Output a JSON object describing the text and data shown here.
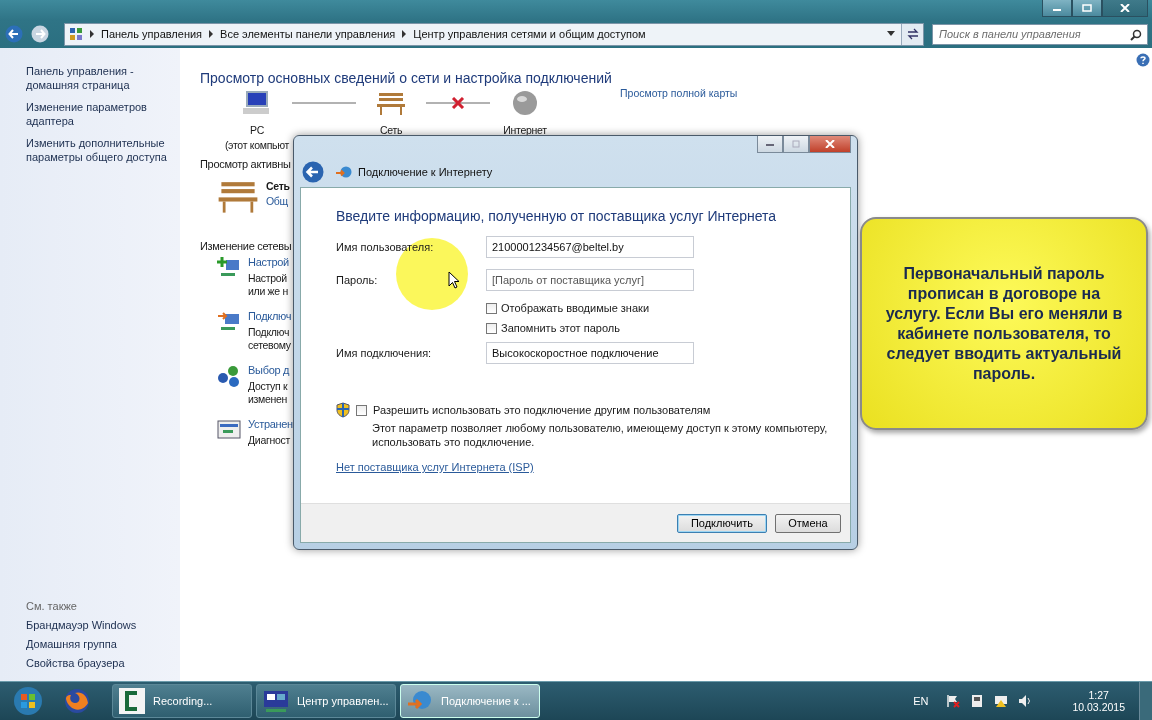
{
  "address_bar": {
    "breadcrumbs": [
      "Панель управления",
      "Все элементы панели управления",
      "Центр управления сетями и общим доступом"
    ],
    "search": {
      "placeholder": "Поиск в панели управления"
    }
  },
  "sidebar": {
    "links": [
      "Панель управления - домашняя страница",
      "Изменение параметров адаптера",
      "Изменить дополнительные параметры общего доступа"
    ],
    "see_also_heading": "См. также",
    "see_also": [
      "Брандмауэр Windows",
      "Домашняя группа",
      "Свойства браузера"
    ]
  },
  "main": {
    "heading": "Просмотр основных сведений о сети и настройка подключений",
    "map": {
      "nodes": [
        {
          "kind": "computer",
          "label": "PC",
          "sublabel": "(этот компьют"
        },
        {
          "kind": "network",
          "label": "Сеть"
        },
        {
          "kind": "internet",
          "label": "Интернет"
        }
      ],
      "connections": [
        {
          "broken": false
        },
        {
          "broken": true
        }
      ],
      "link": "Просмотр полной карты"
    },
    "active_heading": "Просмотр активны",
    "network": {
      "name": "Сеть",
      "type": "Общ"
    },
    "change_heading": "Изменение сетевы",
    "tasks": [
      {
        "kind": "setup",
        "title": "Настрой",
        "lines": [
          "Настрой",
          "или же н"
        ]
      },
      {
        "kind": "connect",
        "title": "Подключ",
        "lines": [
          "Подключ",
          "сетевому"
        ]
      },
      {
        "kind": "homegroup",
        "title": "Выбор д",
        "lines": [
          "Доступ к",
          "изменен"
        ]
      },
      {
        "kind": "troubleshoot",
        "title": "Устранен",
        "lines": [
          "Диагност"
        ]
      }
    ]
  },
  "dialog": {
    "title": "Подключение к Интернету",
    "heading": "Введите информацию, полученную от поставщика услуг Интернета",
    "fields": [
      {
        "label": "Имя пользователя:",
        "value": "2100001234567@beltel.by"
      },
      {
        "label": "Пароль:",
        "placeholder": "[Пароль от поставщика услуг]"
      }
    ],
    "checkboxes": [
      {
        "label": "Отображать вводимые знаки",
        "checked": false
      },
      {
        "label": "Запомнить этот пароль",
        "checked": false
      }
    ],
    "name_field": {
      "label": "Имя подключения:",
      "value": "Высокоскоростное подключение"
    },
    "share": {
      "label": "Разрешить использовать это подключение другим пользователям",
      "checked": false,
      "note": "Этот параметр позволяет любому пользователю, имеющему доступ к этому компьютеру, использовать это подключение."
    },
    "link": "Нет поставщика услуг Интернета (ISP)",
    "buttons": [
      {
        "label": "Подключить",
        "default": true
      },
      {
        "label": "Отмена",
        "default": false
      }
    ]
  },
  "callout": {
    "text": "Первоначальный пароль прописан в договоре на услугу. Если Вы его меняли в кабинете пользователя, то следует вводить актуальный пароль."
  },
  "taskbar": {
    "items": [
      {
        "kind": "firefox",
        "selected": false
      },
      {
        "kind": "recorder",
        "label": "Recording...",
        "selected": false
      },
      {
        "kind": "control",
        "label": "Центр управлен...",
        "selected": false
      },
      {
        "kind": "network",
        "label": "Подключение к ...",
        "selected": true
      }
    ],
    "language": "EN",
    "time": "1:27",
    "date": "10.03.2015"
  }
}
